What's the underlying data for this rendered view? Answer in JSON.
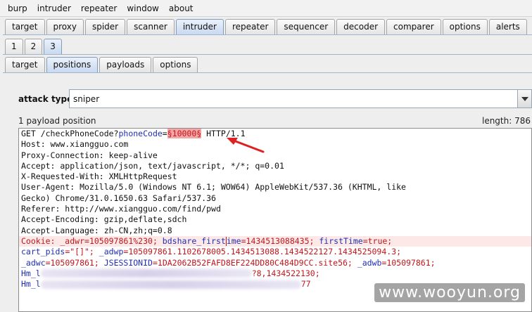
{
  "menu": [
    "burp",
    "intruder",
    "repeater",
    "window",
    "about"
  ],
  "main_tabs": [
    "target",
    "proxy",
    "spider",
    "scanner",
    "intruder",
    "repeater",
    "sequencer",
    "decoder",
    "comparer",
    "options",
    "alerts"
  ],
  "main_tabs_active": "intruder",
  "numbered_tabs": [
    "1",
    "2",
    "3"
  ],
  "numbered_tabs_active": "3",
  "sub_tabs": [
    "target",
    "positions",
    "payloads",
    "options"
  ],
  "sub_tabs_active": "positions",
  "attack": {
    "label": "attack type",
    "value": "sniper"
  },
  "payload_count": "1 payload position",
  "length": "length: 786",
  "request": {
    "l1_a": "GET /checkPhoneCode?",
    "l1_b": "phoneCode",
    "l1_c": "=",
    "l1_marker": "§10000§",
    "l1_d": " HTTP/1.1",
    "l2": "Host: www.xiangguo.com",
    "l3": "Proxy-Connection: keep-alive",
    "l4": "Accept: application/json, text/javascript, */*; q=0.01",
    "l5": "X-Requested-With: XMLHttpRequest",
    "l6": "User-Agent: Mozilla/5.0 (Windows NT 6.1; WOW64) AppleWebKit/537.36 (KHTML, like",
    "l7": "Gecko) Chrome/31.0.1650.63 Safari/537.36",
    "l8": "Referer: http://www.xiangguo.com/find/pwd",
    "l9": "Accept-Encoding: gzip,deflate,sdch",
    "l10": "Accept-Language: zh-CN,zh;q=0.8",
    "c1_key": "Cookie: _adwr",
    "c1_val": "=105097861%230; ",
    "c1_key2a": "bdshare_first",
    "c1_key2b": "ime",
    "c1_val2": "=1434513088435; ",
    "c1_key3": "firstTime",
    "c1_val3": "=true;",
    "c2_key": "cart_pids",
    "c2_val": "=\"[]\"; ",
    "c2_key2": "_adwp",
    "c2_val2": "=105097861.1102678005.1434513088.1434522127.1434525094.3;",
    "c3_key": "_adwc",
    "c3_val": "=105097861; ",
    "c3_key2": "JSESSIONID",
    "c3_val2": "=1DA2062B52FAFD8EF224DD80C484D9CC.site56; ",
    "c3_key3": "_adwb",
    "c3_val3": "=105097861;",
    "c4_a": "Hm_l",
    "c4_b": "",
    "c4_c": "?8,1434522130;",
    "c5_a": "Hm_l",
    "c5_b": "",
    "c5_c": "77"
  },
  "watermark": "www.wooyun.org",
  "colors": {
    "marker_bg": "#f4a6a6",
    "param_blue": "#1f2fb5",
    "cookie_red": "#c2161b",
    "arrow_red": "#e02020"
  }
}
